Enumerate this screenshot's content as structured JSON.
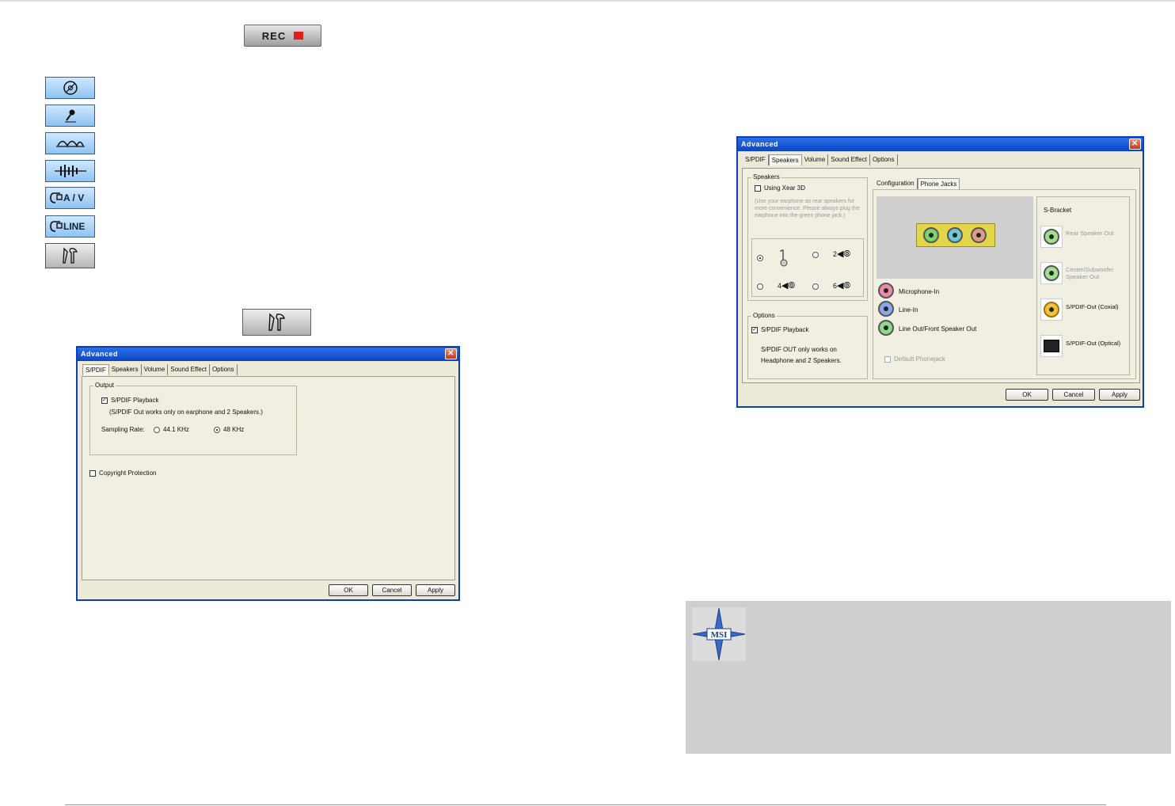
{
  "rec_button": {
    "label": "REC"
  },
  "side_icons": [
    {
      "icon": "disc-icon"
    },
    {
      "icon": "microphone-icon"
    },
    {
      "icon": "wave-icon"
    },
    {
      "icon": "equalizer-icon"
    },
    {
      "icon": "av-icon",
      "label": "A / V"
    },
    {
      "icon": "line-icon",
      "label": "LINE"
    },
    {
      "icon": "tools-icon"
    }
  ],
  "tool_button": {
    "icon": "tools-icon"
  },
  "dialog1": {
    "title": "Advanced",
    "tabs": [
      "S/PDIF",
      "Speakers",
      "Volume",
      "Sound Effect",
      "Options"
    ],
    "active_tab": "S/PDIF",
    "output_group": "Output",
    "spdif_playback": "S/PDIF Playback",
    "spdif_note": "(S/PDIF Out works only on earphone and 2 Speakers.)",
    "sampling_rate": "Sampling Rate:",
    "rate_441": "44.1 KHz",
    "rate_48": "48 KHz",
    "copyright": "Copyright Protection",
    "ok": "OK",
    "cancel": "Cancel",
    "apply": "Apply"
  },
  "dialog2": {
    "title": "Advanced",
    "tabs": [
      "S/PDIF",
      "Speakers",
      "Volume",
      "Sound Effect",
      "Options"
    ],
    "active_tab": "Speakers",
    "speakers_group": "Speakers",
    "using_xear": "Using Xear 3D",
    "xear_note": "(Use your earphone as rear speakers for more convenience. Please always plug the earphone into the green phone jack.)",
    "num_2": "2",
    "num_4": "4",
    "num_6": "6",
    "options_group": "Options",
    "spdif_playback": "S/PDIF Playback",
    "spdif_note": "S/PDIF OUT only works on Headphone and 2 Speakers.",
    "subtabs": [
      "Configuration",
      "Phone Jacks"
    ],
    "active_subtab": "Phone Jacks",
    "mic_in": "Microphone-In",
    "line_in": "Line-In",
    "line_out": "Line Out/Front Speaker Out",
    "default_phonejack": "Default Phonejack",
    "s_bracket": "S-Bracket",
    "rear_speaker": "Rear Speaker Out",
    "center_sub": "Center/Subwoofer Speaker Out",
    "spdif_coaxial": "S/PDIF-Out (Coxial)",
    "spdif_optical": "S/PDIF-Out (Optical)",
    "ok": "OK",
    "cancel": "Cancel",
    "apply": "Apply"
  },
  "note": {
    "logo_text": "MSI"
  },
  "colors": {
    "title_blue": "#0b45c4",
    "note_gray": "#cfcfcf"
  }
}
